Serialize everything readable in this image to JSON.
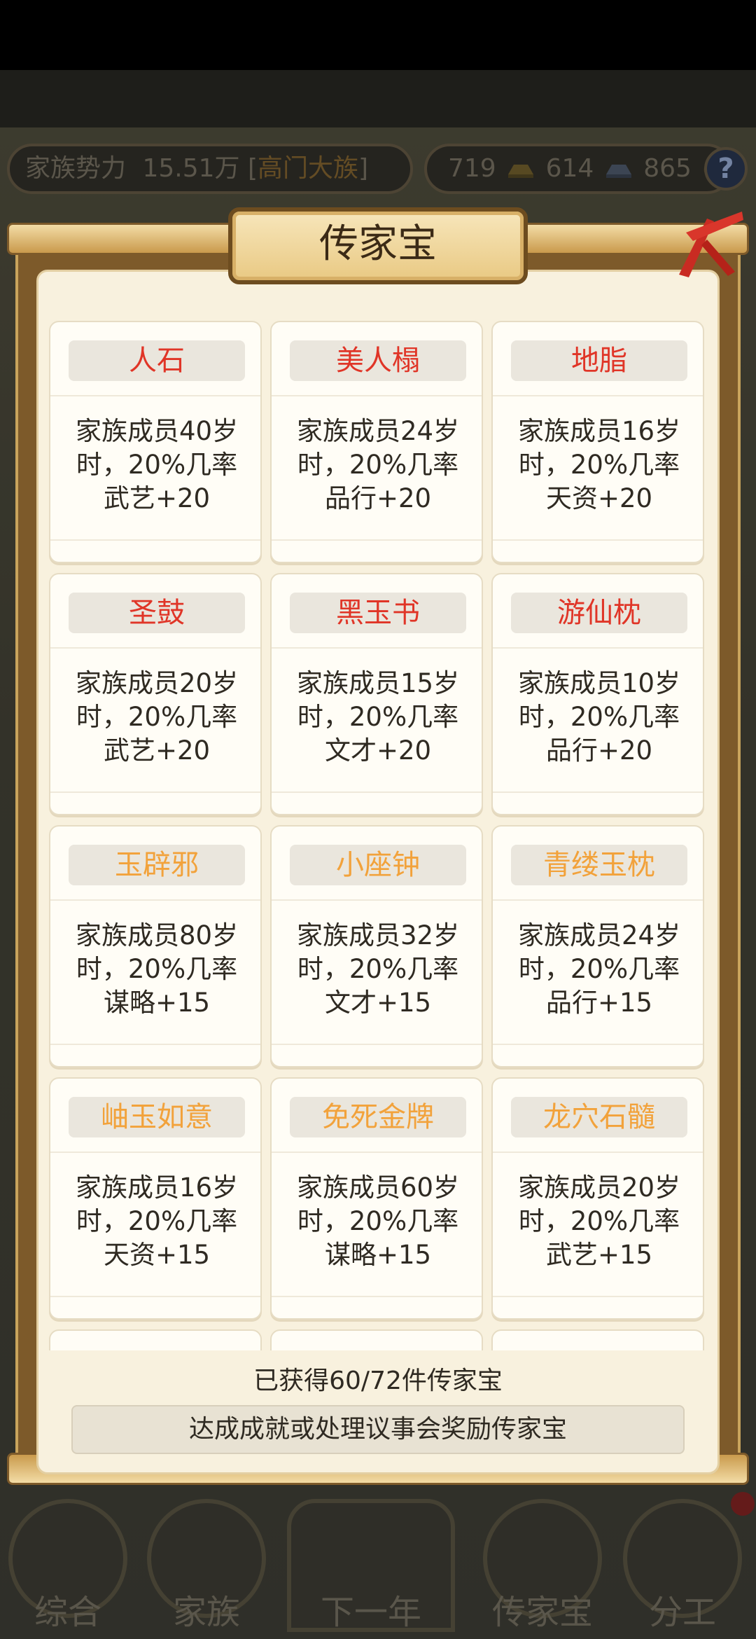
{
  "hud": {
    "power_label": "家族势力",
    "power_value": "15.51万",
    "rank_open": "[",
    "rank": "高门大族",
    "rank_close": "]",
    "gold": "719",
    "silver": "614",
    "coins": "865",
    "help": "?"
  },
  "modal": {
    "title": "传家宝",
    "items": [
      {
        "name": "人石",
        "tier": "red",
        "line1": "家族成员40岁",
        "line2": "时，20%几率",
        "line3": "武艺+20"
      },
      {
        "name": "美人榻",
        "tier": "red",
        "line1": "家族成员24岁",
        "line2": "时，20%几率",
        "line3": "品行+20"
      },
      {
        "name": "地脂",
        "tier": "red",
        "line1": "家族成员16岁",
        "line2": "时，20%几率",
        "line3": "天资+20"
      },
      {
        "name": "圣鼓",
        "tier": "red",
        "line1": "家族成员20岁",
        "line2": "时，20%几率",
        "line3": "武艺+20"
      },
      {
        "name": "黑玉书",
        "tier": "red",
        "line1": "家族成员15岁",
        "line2": "时，20%几率",
        "line3": "文才+20"
      },
      {
        "name": "游仙枕",
        "tier": "red",
        "line1": "家族成员10岁",
        "line2": "时，20%几率",
        "line3": "品行+20"
      },
      {
        "name": "玉辟邪",
        "tier": "orange",
        "line1": "家族成员80岁",
        "line2": "时，20%几率",
        "line3": "谋略+15"
      },
      {
        "name": "小座钟",
        "tier": "orange",
        "line1": "家族成员32岁",
        "line2": "时，20%几率",
        "line3": "文才+15"
      },
      {
        "name": "青缕玉枕",
        "tier": "orange",
        "line1": "家族成员24岁",
        "line2": "时，20%几率",
        "line3": "品行+15"
      },
      {
        "name": "岫玉如意",
        "tier": "orange",
        "line1": "家族成员16岁",
        "line2": "时，20%几率",
        "line3": "天资+15"
      },
      {
        "name": "免死金牌",
        "tier": "orange",
        "line1": "家族成员60岁",
        "line2": "时，20%几率",
        "line3": "谋略+15"
      },
      {
        "name": "龙穴石髓",
        "tier": "orange",
        "line1": "家族成员20岁",
        "line2": "时，20%几率",
        "line3": "武艺+15"
      }
    ],
    "count_text": "已获得60/72件传家宝",
    "hint_text": "达成成就或处理议事会奖励传家宝"
  },
  "nav": {
    "items": [
      "综合",
      "家族",
      "下一年",
      "传家宝",
      "分工"
    ]
  },
  "colors": {
    "red_tier": "#e03527",
    "orange_tier": "#f2a23b",
    "frame": "#7d5a2a",
    "paper": "#f8f1de"
  }
}
